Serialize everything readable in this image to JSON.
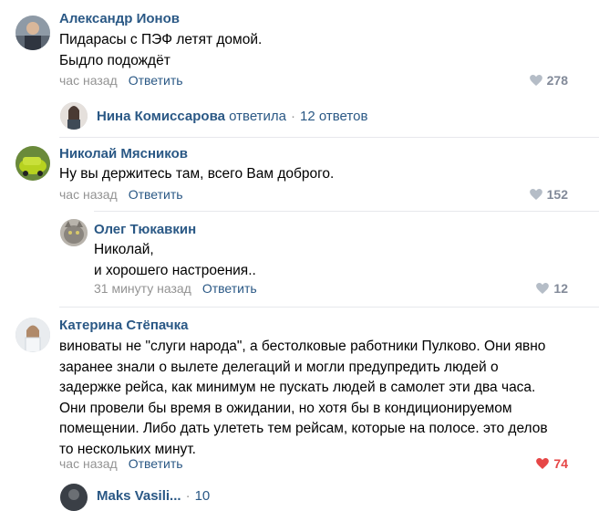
{
  "comments": [
    {
      "author": "Александр Ионов",
      "lines": "Пидарасы с ПЭФ летят домой.\nБыдло подождёт",
      "time": "час назад",
      "reply": "Ответить",
      "likes": "278"
    },
    {
      "author": "Николай Мясников",
      "lines": "Ну вы держитесь там, всего Вам доброго.",
      "time": "час назад",
      "reply": "Ответить",
      "likes": "152"
    },
    {
      "author": "Олег Тюкавкин",
      "lines": "Николай,\nи хорошего настроения..",
      "time": "31 минуту назад",
      "reply": "Ответить",
      "likes": "12"
    },
    {
      "author": "Катерина Стёпачка",
      "lines": "виноваты не \"слуги народа\", а бестолковые работники Пулково. Они явно\nзаранее знали о вылете делегаций и могли предупредить людей о\nзадержке рейса, как минимум не пускать людей в самолет эти два часа.\nОни провели бы время в ожидании, но хотя бы в кондиционируемом\nпомещении. Либо дать улететь тем рейсам, которые на полосе. это делов\nто нескольких минут.",
      "time": "час назад",
      "reply": "Ответить",
      "likes": "74"
    }
  ],
  "thread": {
    "name": "Нина Комиссарова",
    "verb": "ответила",
    "count": "12 ответов"
  },
  "partial": {
    "name": "Maks Vasili...",
    "count": "10"
  },
  "colors": {
    "link": "#2a5885",
    "meta": "#939393",
    "like_active": "#e64646",
    "like_idle": "#828a99"
  }
}
